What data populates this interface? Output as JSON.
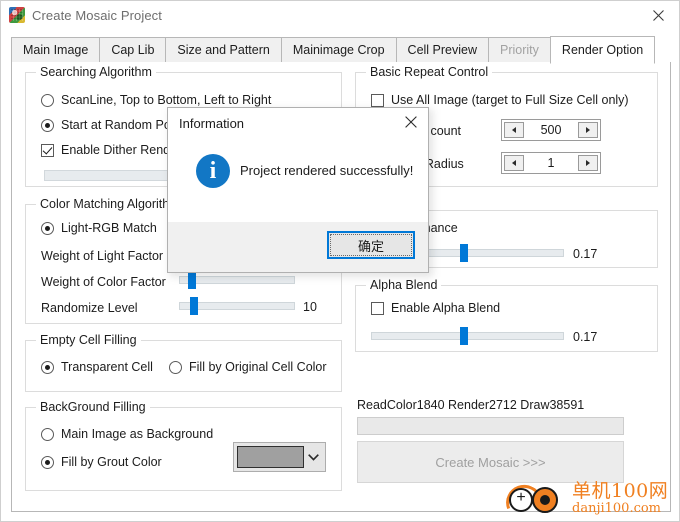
{
  "window": {
    "title": "Create Mosaic Project",
    "app_icon": "mosaic-app-icon",
    "close_icon": "close-icon"
  },
  "tabs": [
    {
      "label": "Main Image",
      "state": "normal"
    },
    {
      "label": "Cap Lib",
      "state": "normal"
    },
    {
      "label": "Size and Pattern",
      "state": "normal"
    },
    {
      "label": "Mainimage Crop",
      "state": "normal"
    },
    {
      "label": "Cell Preview",
      "state": "normal"
    },
    {
      "label": "Priority",
      "state": "disabled"
    },
    {
      "label": "Render Option",
      "state": "active"
    }
  ],
  "searching_algorithm": {
    "title": "Searching Algorithm",
    "options": [
      {
        "label": "ScanLine, Top to Bottom, Left to Right",
        "selected": false
      },
      {
        "label": "Start at Random Pos",
        "selected": true
      }
    ],
    "dither": {
      "label": "Enable Dither Rende",
      "checked": true
    }
  },
  "color_matching": {
    "title": "Color Matching Algorithm",
    "option": {
      "label": "Light-RGB Match",
      "selected": true
    },
    "sliders": [
      {
        "label": "Weight of Light Factor",
        "value": "",
        "pos_pct": 0
      },
      {
        "label": "Weight of Color Factor",
        "value": "",
        "pos_pct": 11
      },
      {
        "label": "Randomize Level",
        "value": "10",
        "pos_pct": 13
      }
    ]
  },
  "empty_cell_filling": {
    "title": "Empty Cell Filling",
    "options": [
      {
        "label": "Transparent Cell",
        "selected": true
      },
      {
        "label": "Fill by Original Cell Color",
        "selected": false
      }
    ]
  },
  "background_filling": {
    "title": "BackGround Filling",
    "options": [
      {
        "label": "Main Image as Background",
        "selected": false
      },
      {
        "label": "Fill by Grout Color",
        "selected": true
      }
    ],
    "grout_color": "#a0a0a0",
    "chevron_icon": "chevron-down-icon"
  },
  "basic_repeat_control": {
    "title": "Basic Repeat Control",
    "use_all_image": {
      "label": "Use All Image (target to Full Size Cell only)",
      "checked": false
    },
    "spinners": [
      {
        "label": "tile count",
        "value": "500"
      },
      {
        "label": "at Radius",
        "value": "1"
      }
    ]
  },
  "color_enhance": {
    "title": "e",
    "checkbox": {
      "label": "lor Enhance",
      "checked": false
    },
    "slider": {
      "value": "0.17",
      "pos_pct": 48
    }
  },
  "alpha_blend": {
    "title": "Alpha Blend",
    "checkbox": {
      "label": "Enable Alpha Blend",
      "checked": false
    },
    "slider": {
      "value": "0.17",
      "pos_pct": 48
    }
  },
  "render_status": {
    "text": "ReadColor1840  Render2712  Draw38591",
    "progress_pct": 0,
    "create_button": "Create Mosaic >>>"
  },
  "dialog": {
    "title": "Information",
    "close_icon": "close-icon",
    "icon": "info-icon",
    "icon_glyph": "i",
    "message": "Project rendered successfully!",
    "ok_label": "确定",
    "accent": "#0078d7"
  },
  "watermark": {
    "cn": "单机100网",
    "en": "danji100.com"
  }
}
